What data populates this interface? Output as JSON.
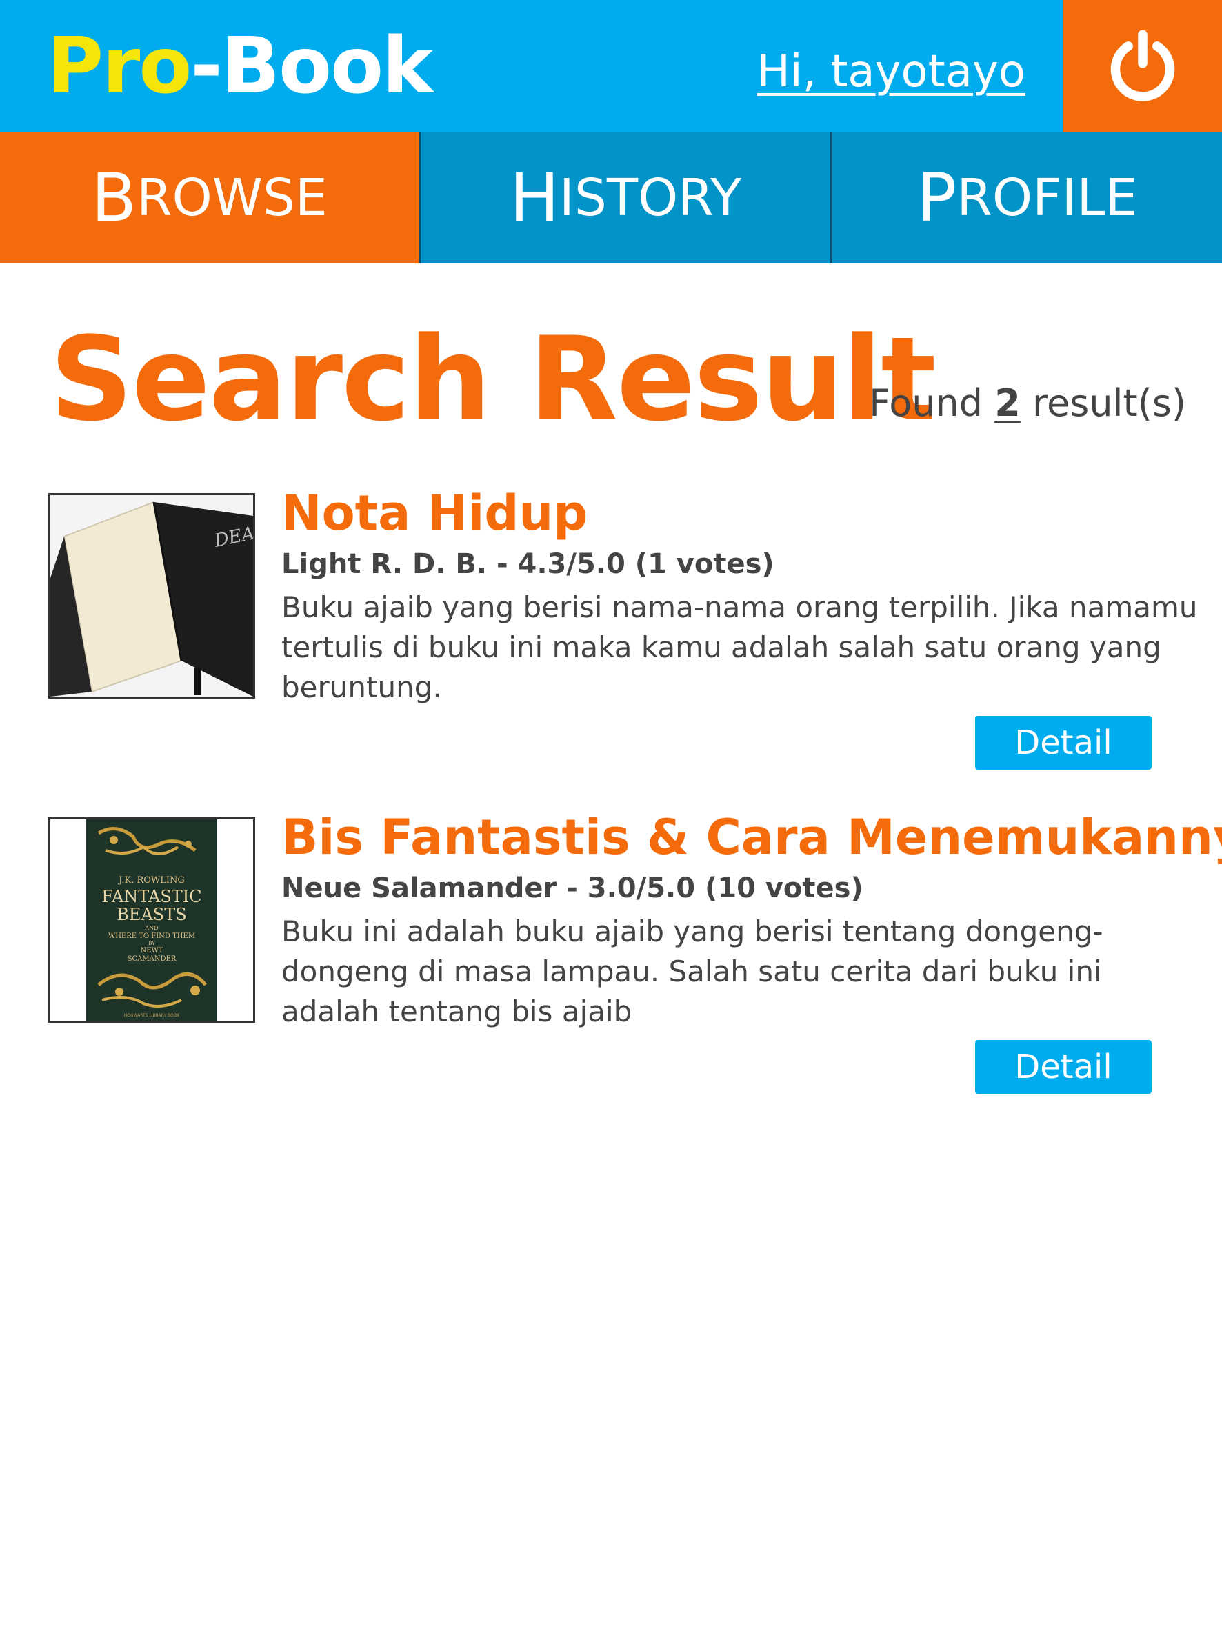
{
  "header": {
    "logo_pro": "Pro",
    "logo_dash": "-",
    "logo_book": "Book",
    "greeting": "Hi, tayotayo",
    "logout_icon": "power-icon",
    "colors": {
      "header_bg": "#00aced",
      "logout_bg": "#f36b0b",
      "logo_pro": "#f5e50a"
    }
  },
  "nav": {
    "tabs": [
      {
        "cap": "B",
        "rest": "ROWSE",
        "active": true
      },
      {
        "cap": "H",
        "rest": "ISTORY",
        "active": false
      },
      {
        "cap": "P",
        "rest": "ROFILE",
        "active": false
      }
    ],
    "colors": {
      "active": "#f36b0b",
      "inactive": "#0293c9"
    }
  },
  "main": {
    "title": "Search Result",
    "found_prefix": "Found",
    "found_count": "2",
    "found_suffix": "result(s)",
    "results": [
      {
        "title": "Nota Hidup",
        "meta": "Light R. D. B. - 4.3/5.0 (1 votes)",
        "description": "Buku ajaib yang berisi nama-nama orang terpilih. Jika namamu tertulis di buku ini maka kamu adalah salah satu orang yang beruntung.",
        "cover_text": "DEATH",
        "detail_label": "Detail"
      },
      {
        "title": "Bis Fantastis & Cara Menemukannya",
        "meta": "Neue Salamander - 3.0/5.0 (10 votes)",
        "description": "Buku ini adalah buku ajaib yang berisi tentang dongeng-dongeng di masa lampau. Salah satu cerita dari buku ini adalah tentang bis ajaib",
        "cover_author": "J.K. ROWLING",
        "cover_title_1": "FANTASTIC",
        "cover_title_2": "BEASTS",
        "cover_and": "AND",
        "cover_subtitle": "WHERE TO FIND THEM",
        "cover_by": "BY",
        "cover_pen_1": "NEWT",
        "cover_pen_2": "SCAMANDER",
        "cover_footer": "HOGWARTS LIBRARY BOOK",
        "detail_label": "Detail"
      }
    ]
  }
}
